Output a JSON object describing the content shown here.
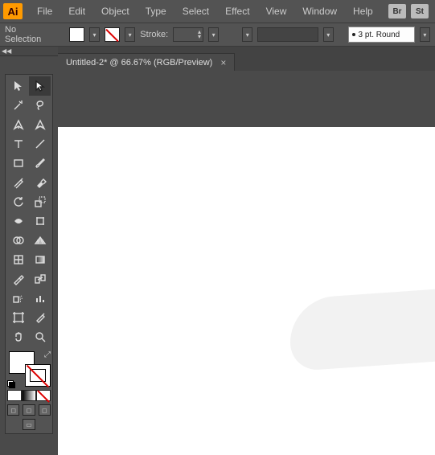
{
  "app": {
    "logo": "Ai"
  },
  "menu": {
    "file": "File",
    "edit": "Edit",
    "object": "Object",
    "type": "Type",
    "select": "Select",
    "effect": "Effect",
    "view": "View",
    "window": "Window",
    "help": "Help",
    "br_btn": "Br",
    "st_btn": "St"
  },
  "controlbar": {
    "selection_status": "No Selection",
    "stroke_label": "Stroke:",
    "variable_width_profile": "3 pt. Round"
  },
  "document": {
    "tab_title": "Untitled-2* @ 66.67% (RGB/Preview)",
    "close_glyph": "×"
  },
  "collapse": {
    "arrows": "◀◀",
    "label": ""
  }
}
